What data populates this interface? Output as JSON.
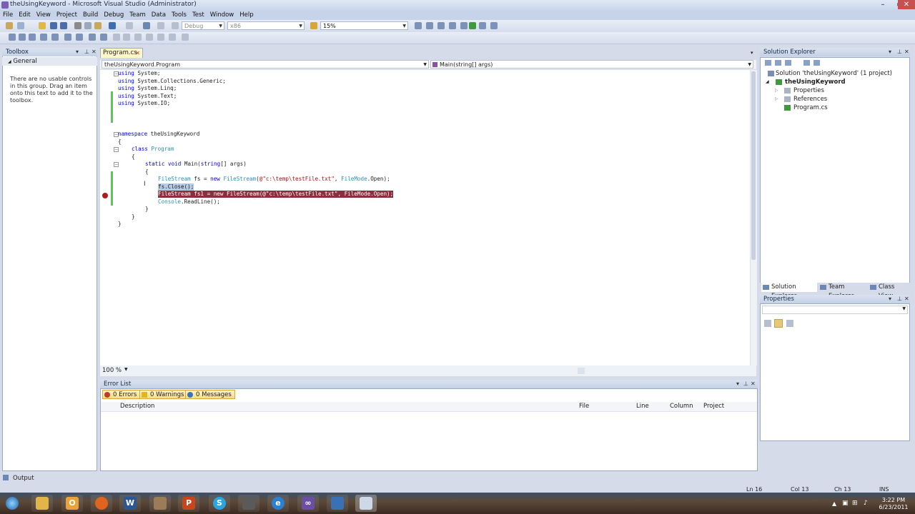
{
  "window": {
    "title": "theUsingKeyword - Microsoft Visual Studio (Administrator)"
  },
  "menu": [
    "File",
    "Edit",
    "View",
    "Project",
    "Build",
    "Debug",
    "Team",
    "Data",
    "Tools",
    "Test",
    "Window",
    "Help"
  ],
  "toolbar": {
    "config": "Debug",
    "platform": "x86",
    "find": "15%"
  },
  "toolbox": {
    "title": "Toolbox",
    "group": "General",
    "empty_text": "There are no usable controls in this group. Drag an item onto this text to add it to the toolbox."
  },
  "editor": {
    "tab": "Program.cs",
    "nav_left": "theUsingKeyword.Program",
    "nav_right": "Main(string[] args)",
    "zoom": "100 %",
    "lines": [
      "using System;",
      "using System.Collections.Generic;",
      "using System.Linq;",
      "using System.Text;",
      "using System.IO;",
      "namespace theUsingKeyword",
      "{",
      "class Program",
      "{",
      "static void Main(string[] args)",
      "{",
      "FileStream fs = new FileStream(@\"c:\\temp\\testFile.txt\", FileMode.Open);",
      "fs.Close();",
      "FileStream fs1 = new FileStream(@\"c:\\temp\\testFile.txt\", FileMode.Open);",
      "Console.ReadLine();",
      "}",
      "}",
      "}"
    ]
  },
  "error_list": {
    "title": "Error List",
    "errors": "0 Errors",
    "warnings": "0 Warnings",
    "messages": "0 Messages",
    "columns": [
      "Description",
      "File",
      "Line",
      "Column",
      "Project"
    ]
  },
  "solution_explorer": {
    "title": "Solution Explorer",
    "items": [
      "Solution 'theUsingKeyword' (1 project)",
      "theUsingKeyword",
      "Properties",
      "References",
      "Program.cs"
    ],
    "tabs": [
      "Solution Explorer",
      "Team Explorer",
      "Class View"
    ]
  },
  "properties": {
    "title": "Properties"
  },
  "status": {
    "output": "Output",
    "ln": "Ln 16",
    "col": "Col 13",
    "ch": "Ch 13",
    "mode": "INS"
  },
  "clock": {
    "time": "3:22 PM",
    "date": "6/23/2011"
  }
}
